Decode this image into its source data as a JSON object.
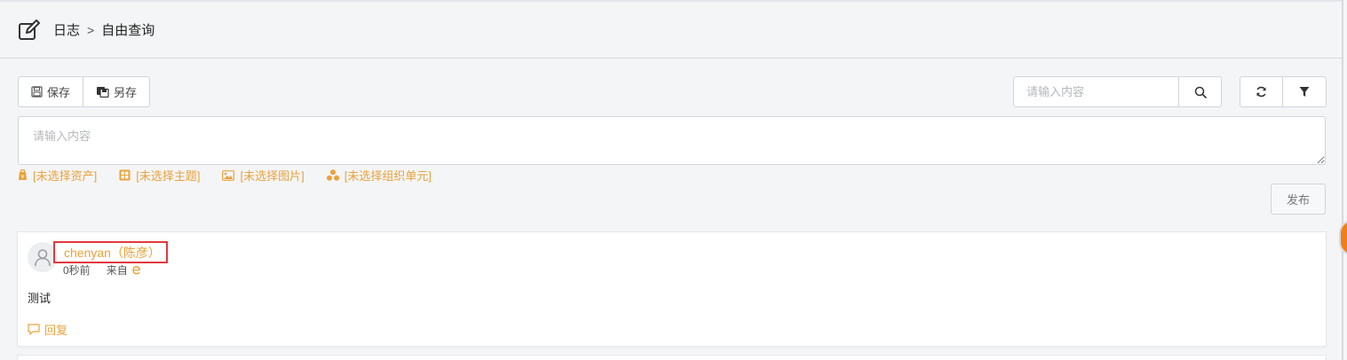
{
  "breadcrumb": {
    "root": "日志",
    "separator": ">",
    "current": "自由查询"
  },
  "toolbar": {
    "save_label": "保存",
    "save_as_label": "另存"
  },
  "search": {
    "placeholder": "请输入内容"
  },
  "compose": {
    "placeholder": "请输入内容"
  },
  "selectors": [
    {
      "label": "[未选择资产]",
      "icon": "asset-icon"
    },
    {
      "label": "[未选择主题]",
      "icon": "topic-icon"
    },
    {
      "label": "[未选择图片]",
      "icon": "image-icon"
    },
    {
      "label": "[未选择组织单元]",
      "icon": "org-unit-icon"
    }
  ],
  "publish_label": "发布",
  "post": {
    "author": "chenyan（陈彦）",
    "time": "0秒前",
    "source_label": "来自",
    "source_icon": "ie-browser-icon",
    "content": "测试",
    "reply_label": "回复"
  },
  "colors": {
    "accent": "#e9a23b",
    "highlight_box": "#e0393e",
    "side_tab": "#ef7f1a"
  }
}
